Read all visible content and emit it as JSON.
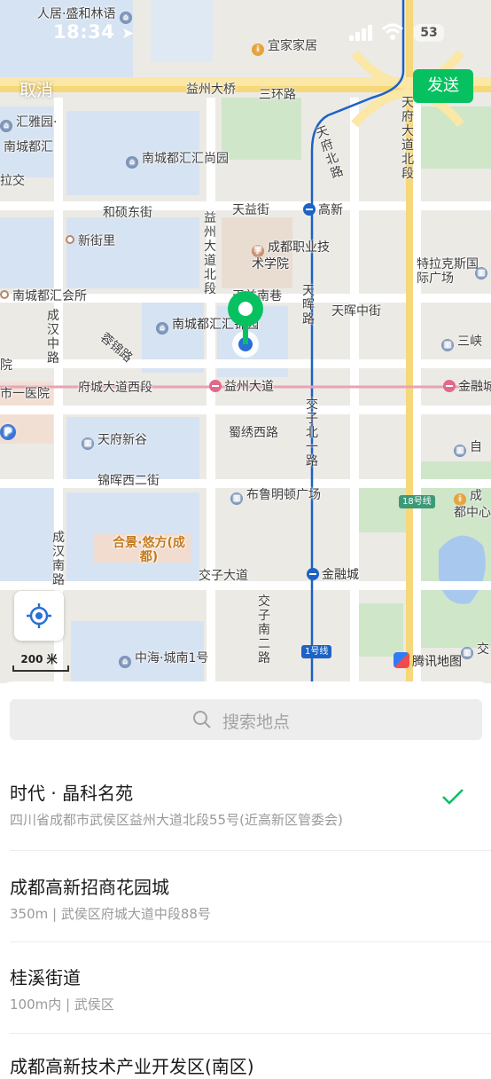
{
  "status_bar": {
    "time": "18:34",
    "battery": "53"
  },
  "nav": {
    "cancel": "取消",
    "send": "发送"
  },
  "map": {
    "labels": {
      "renju": "人居·盛和林语",
      "ikea": "宜家家居",
      "yizhou_bridge": "益州大桥",
      "third_ring": "三环路",
      "tianfu_north": "天府大道北段",
      "huiya": "汇雅园·",
      "nancheng_duhui": "南城都汇",
      "lajiao": "拉交",
      "shangyuan": "南城都汇汇尚园",
      "tianyi_north": "天府北路",
      "heshuo_east": "和硕东街",
      "tianyi_st": "天益街",
      "gaoxin": "高新",
      "yizhou_north": "益州大道北段",
      "xinjieli": "新街里",
      "vocational": "成都职业技术学院",
      "telakesi": "特拉克斯国际广场",
      "nancheng_huisuo": "南城都汇会所",
      "tiannan_alley": "天益南巷",
      "chenghan_middle": "成汉中路",
      "tianhui": "天晖路",
      "tianhui_middle": "天晖中街",
      "rongjin": "蓉锦路",
      "huiyuan": "南城都汇汇锦园",
      "sanxia": "三峡",
      "yuan": "院",
      "first_hospital": "市一医院",
      "fucheng_west": "府城大道西段",
      "yizhou_avenue": "益州大道",
      "jinrong_st": "金融城",
      "jiaozi_north": "交子北一路",
      "shuxiu_west": "蜀绣西路",
      "tianfu_xingu": "天府新谷",
      "jinhui_west": "锦晖西二街",
      "brompton": "布鲁明顿广场",
      "line18": "18号线",
      "chengdu_mid": "成都中心",
      "chenghan_south": "成汉南路",
      "hejing": "合景·悠方(成都)",
      "jiaozi_avenue": "交子大道",
      "jinrong_city": "金融城",
      "jiaozi_south": "交子南二路",
      "line1": "1号线",
      "zhonghai": "中海·城南1号",
      "tencent_maps": "腾讯地图",
      "jiao": "交",
      "dian": "自"
    },
    "scale": "200 米"
  },
  "search": {
    "placeholder": "搜索地点"
  },
  "results": [
    {
      "name": "时代 · 晶科名苑",
      "address": "四川省成都市武侯区益州大道北段55号(近高新区管委会)",
      "selected": true
    },
    {
      "name": "成都高新招商花园城",
      "address": "350m | 武侯区府城大道中段88号",
      "selected": false
    },
    {
      "name": "桂溪街道",
      "address": "100m内 | 武侯区",
      "selected": false
    },
    {
      "name": "成都高新技术产业开发区(南区)",
      "address": "",
      "selected": false
    }
  ],
  "colors": {
    "accent": "#07c160",
    "metro_blue": "#1d62c4",
    "metro_pink": "#e16a8c"
  }
}
